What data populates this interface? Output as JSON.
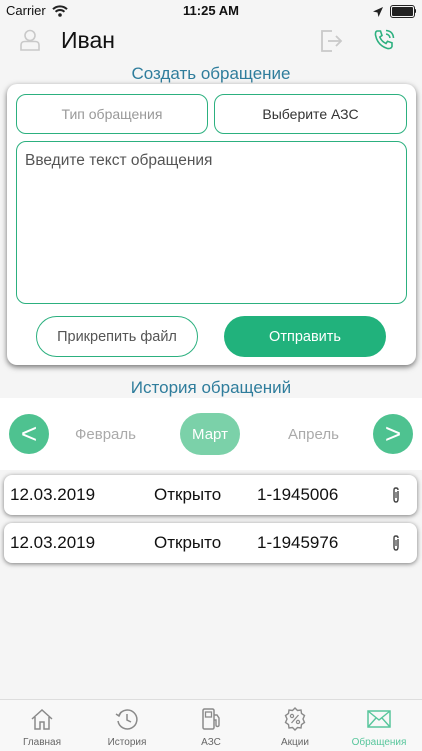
{
  "status_bar": {
    "carrier": "Carrier",
    "time": "11:25 AM"
  },
  "header": {
    "user_name": "Иван"
  },
  "create": {
    "title": "Создать обращение",
    "type_placeholder": "Тип обращения",
    "station_label": "Выберите АЗС",
    "message_placeholder": "Введите текст обращения",
    "attach_label": "Прикрепить файл",
    "send_label": "Отправить"
  },
  "history": {
    "title": "История обращений",
    "months": {
      "prev": "Февраль",
      "current": "Март",
      "next": "Апрель",
      "prev_arrow": "<",
      "next_arrow": ">"
    },
    "rows": [
      {
        "date": "12.03.2019",
        "status": "Открыто",
        "id": "1-1945006",
        "icon": "paperclip-icon"
      },
      {
        "date": "12.03.2019",
        "status": "Открыто",
        "id": "1-1945976",
        "icon": "paperclip-icon"
      }
    ]
  },
  "tabs": [
    {
      "label": "Главная",
      "icon": "home-icon"
    },
    {
      "label": "История",
      "icon": "history-icon"
    },
    {
      "label": "АЗС",
      "icon": "fuel-pump-icon"
    },
    {
      "label": "Акции",
      "icon": "discount-icon"
    },
    {
      "label": "Обращения",
      "icon": "envelope-icon",
      "active": true
    }
  ],
  "colors": {
    "accent": "#21b27c",
    "title": "#2f7d9c",
    "month_active": "#7bd1a9",
    "arrow": "#4ec290"
  }
}
